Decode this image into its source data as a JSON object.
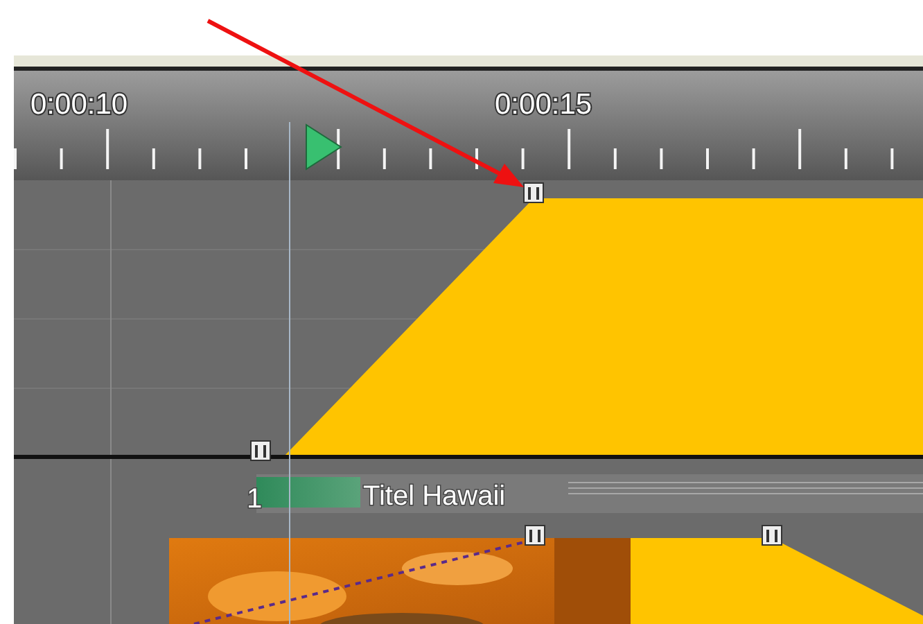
{
  "ruler": {
    "labels": [
      "0:00:10",
      "0:00:15"
    ]
  },
  "clip": {
    "number": "1",
    "title": "Titel Hawaii"
  }
}
